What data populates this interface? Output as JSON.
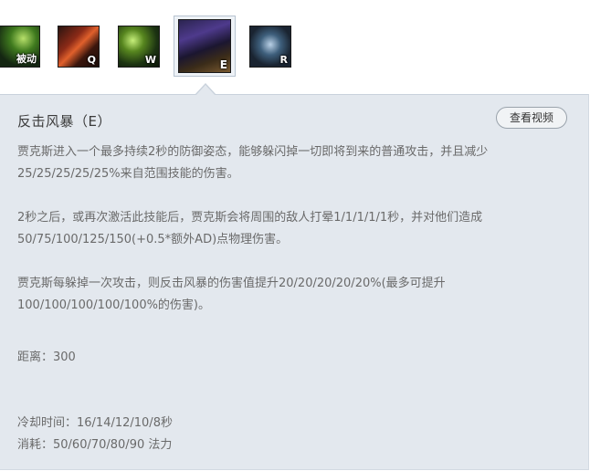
{
  "skills": [
    {
      "name": "passive",
      "key": "被动"
    },
    {
      "name": "q",
      "key": "Q"
    },
    {
      "name": "w",
      "key": "W"
    },
    {
      "name": "e",
      "key": "E"
    },
    {
      "name": "r",
      "key": "R"
    }
  ],
  "selected_skill": "E",
  "panel": {
    "title": "反击风暴（E）",
    "video_button": "查看视频",
    "paragraphs": [
      [
        "贾克斯进入一个最多持续2秒的防御姿态，能够躲闪掉一切即将到来的普通攻击，并且减少",
        "25/25/25/25/25%来自范围技能的伤害。"
      ],
      [
        "2秒之后，或再次激活此技能后，贾克斯会将周围的敌人打晕1/1/1/1/1秒，并对他们造成",
        "50/75/100/125/150(+0.5*额外AD)点物理伤害。"
      ],
      [
        "贾克斯每躲掉一次攻击，则反击风暴的伤害值提升20/20/20/20/20%(最多可提升",
        "100/100/100/100/100%的伤害)。"
      ]
    ],
    "range": "距离：300",
    "cooldown": "冷却时间：16/14/12/10/8秒",
    "cost": "消耗：50/60/70/80/90 法力"
  }
}
